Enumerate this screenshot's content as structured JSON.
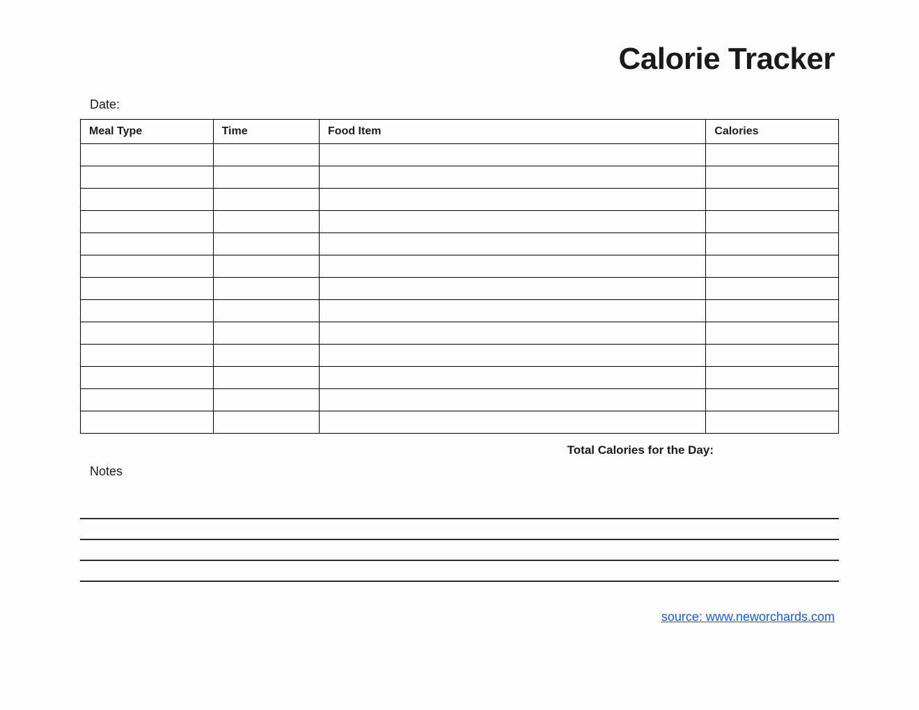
{
  "title": "Calorie Tracker",
  "date_label": "Date:",
  "columns": {
    "meal": "Meal Type",
    "time": "Time",
    "food": "Food Item",
    "calories": "Calories"
  },
  "rows": [
    {
      "meal": "",
      "time": "",
      "food": "",
      "calories": ""
    },
    {
      "meal": "",
      "time": "",
      "food": "",
      "calories": ""
    },
    {
      "meal": "",
      "time": "",
      "food": "",
      "calories": ""
    },
    {
      "meal": "",
      "time": "",
      "food": "",
      "calories": ""
    },
    {
      "meal": "",
      "time": "",
      "food": "",
      "calories": ""
    },
    {
      "meal": "",
      "time": "",
      "food": "",
      "calories": ""
    },
    {
      "meal": "",
      "time": "",
      "food": "",
      "calories": ""
    },
    {
      "meal": "",
      "time": "",
      "food": "",
      "calories": ""
    },
    {
      "meal": "",
      "time": "",
      "food": "",
      "calories": ""
    },
    {
      "meal": "",
      "time": "",
      "food": "",
      "calories": ""
    },
    {
      "meal": "",
      "time": "",
      "food": "",
      "calories": ""
    },
    {
      "meal": "",
      "time": "",
      "food": "",
      "calories": ""
    },
    {
      "meal": "",
      "time": "",
      "food": "",
      "calories": ""
    }
  ],
  "total_label": "Total Calories for the Day:",
  "notes_label": "Notes",
  "notes_line_count": 4,
  "source": {
    "text": "source: www.neworchards.com",
    "href": "#"
  }
}
